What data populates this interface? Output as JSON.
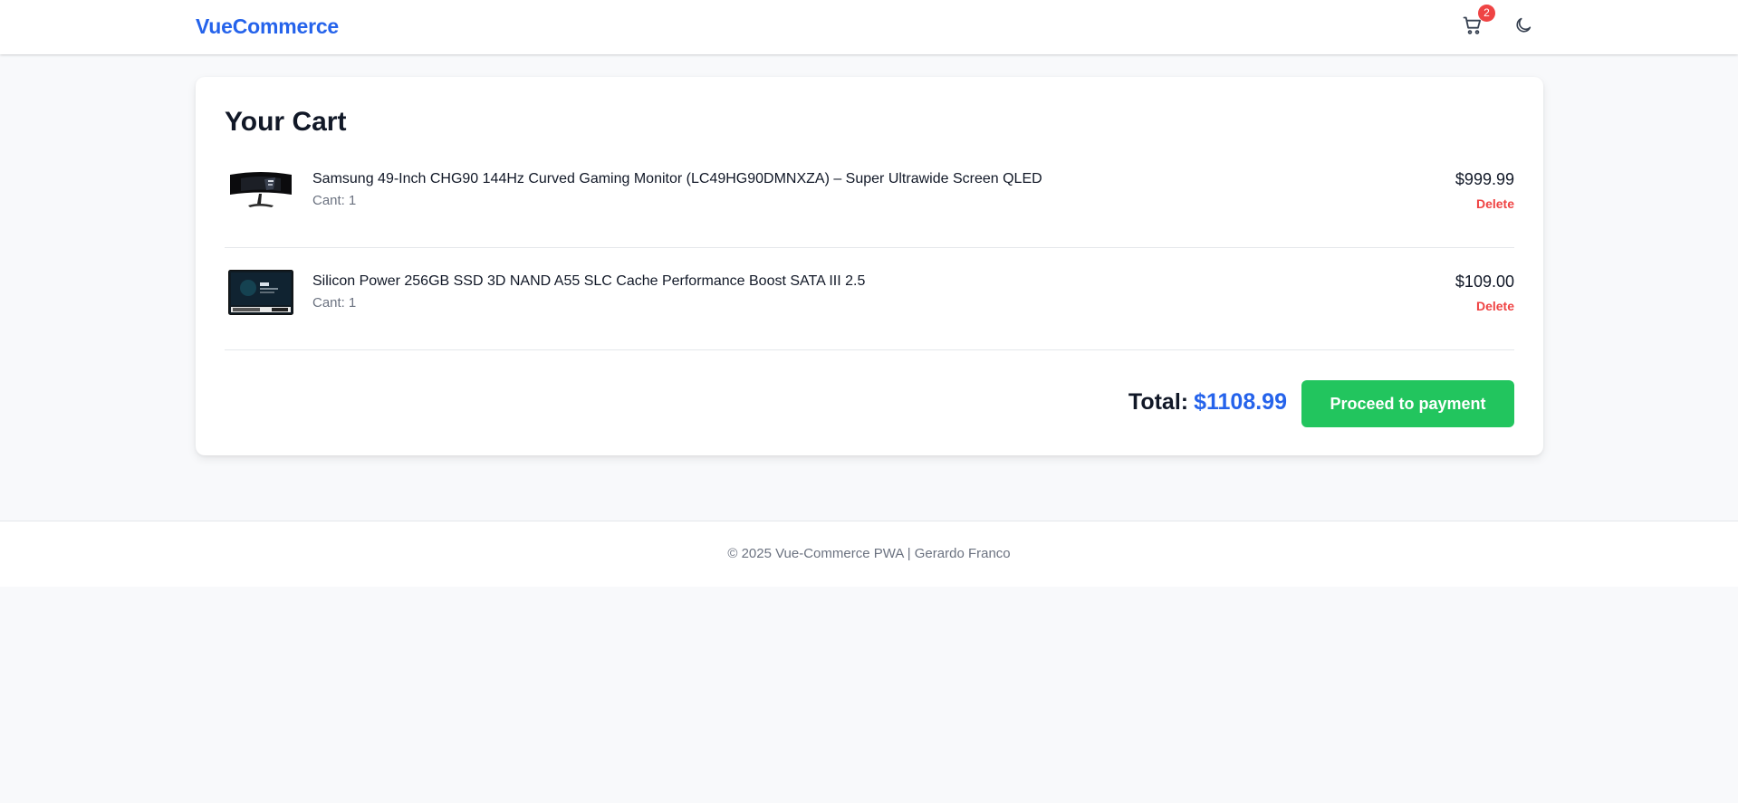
{
  "header": {
    "brand": "VueCommerce",
    "cart_icon": "cart-icon",
    "cart_count": "2",
    "theme_icon": "moon-icon"
  },
  "cart": {
    "title": "Your Cart",
    "qty_label": "Cant:",
    "delete_label": "Delete",
    "items": [
      {
        "name": "Samsung 49-Inch CHG90 144Hz Curved Gaming Monitor (LC49HG90DMNXZA) – Super Ultrawide Screen QLED",
        "qty": "1",
        "price": "$999.99",
        "image": "monitor-image"
      },
      {
        "name": "Silicon Power 256GB SSD 3D NAND A55 SLC Cache Performance Boost SATA III 2.5",
        "qty": "1",
        "price": "$109.00",
        "image": "ssd-image"
      }
    ],
    "total_label": "Total:",
    "total_value": "$1108.99",
    "pay_label": "Proceed to payment"
  },
  "footer": {
    "text": "© 2025 Vue-Commerce PWA | Gerardo Franco"
  },
  "colors": {
    "brand": "#2563eb",
    "badge": "#ef4444",
    "delete": "#ef4444",
    "pay_button": "#22c55e",
    "total": "#2563eb"
  }
}
